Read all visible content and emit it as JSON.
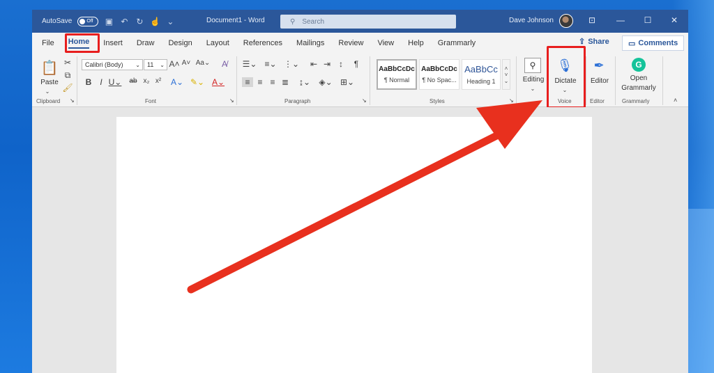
{
  "titlebar": {
    "autosave_label": "AutoSave",
    "autosave_state": "Off",
    "doc_title": "Document1  -  Word",
    "search_placeholder": "Search",
    "user_name": "Dave Johnson"
  },
  "menu": {
    "tabs": [
      "File",
      "Home",
      "Insert",
      "Draw",
      "Design",
      "Layout",
      "References",
      "Mailings",
      "Review",
      "View",
      "Help",
      "Grammarly"
    ],
    "active_tab": "Home",
    "share_label": "Share",
    "comments_label": "Comments"
  },
  "ribbon": {
    "clipboard": {
      "paste_label": "Paste",
      "group_label": "Clipboard"
    },
    "font": {
      "font_name": "Calibri (Body)",
      "font_size": "11",
      "group_label": "Font"
    },
    "paragraph": {
      "group_label": "Paragraph"
    },
    "styles": {
      "group_label": "Styles",
      "items": [
        {
          "sample": "AaBbCcDc",
          "name": "¶ Normal"
        },
        {
          "sample": "AaBbCcDc",
          "name": "¶ No Spac..."
        },
        {
          "sample": "AaBbCc",
          "name": "Heading 1"
        }
      ]
    },
    "editing": {
      "label": "Editing"
    },
    "voice": {
      "dictate_label": "Dictate",
      "group_label": "Voice"
    },
    "editor": {
      "label": "Editor",
      "group_label": "Editor"
    },
    "grammarly": {
      "label_line1": "Open",
      "label_line2": "Grammarly",
      "group_label": "Grammarly"
    }
  },
  "colors": {
    "title_bar": "#2b579a",
    "highlight": "#e81e1e",
    "grammarly": "#15c39a"
  }
}
